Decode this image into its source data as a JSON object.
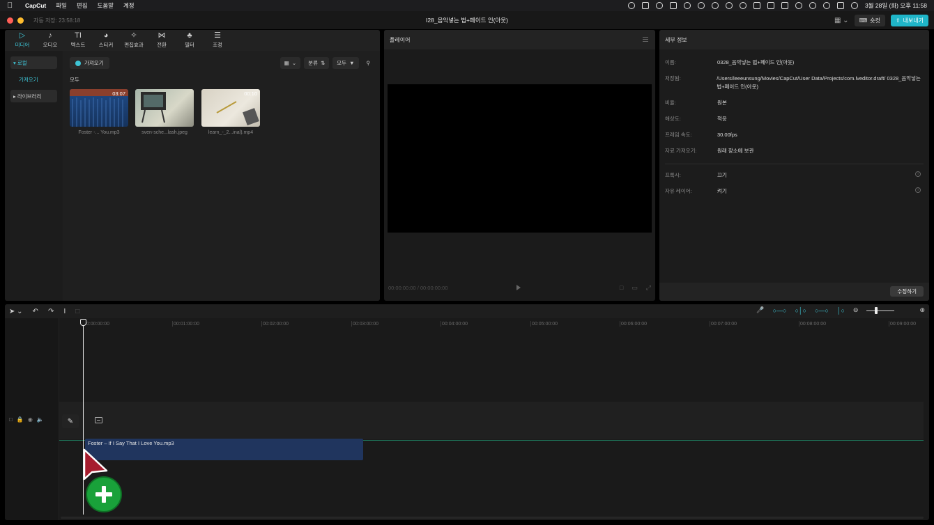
{
  "menubar": {
    "app": "CapCut",
    "items": [
      "파일",
      "편집",
      "도움말",
      "계정"
    ],
    "clock": "3월 28일 (화) 오후 11:58"
  },
  "window": {
    "autosave": "자동 저장: 23:58:18",
    "title": "I28_음악넣는 법+페이드 인(아웃)",
    "shortcut": "숏컷",
    "export": "내보내기"
  },
  "media": {
    "tabs": [
      {
        "label": "미디어",
        "icon": "media-icon"
      },
      {
        "label": "오디오",
        "icon": "audio-icon"
      },
      {
        "label": "텍스트",
        "icon": "text-icon"
      },
      {
        "label": "스티커",
        "icon": "sticker-icon"
      },
      {
        "label": "편집효과",
        "icon": "effects-icon"
      },
      {
        "label": "전환",
        "icon": "transition-icon"
      },
      {
        "label": "필터",
        "icon": "filter-icon"
      },
      {
        "label": "조정",
        "icon": "adjust-icon"
      }
    ],
    "sidebar": {
      "local": "로컬",
      "import": "가져오기",
      "library": "라이브러리"
    },
    "import_button": "가져오기",
    "sort_label": "분류",
    "filter_label": "모두",
    "section": "모두",
    "items": [
      {
        "name": "Foster -... You.mp3",
        "duration": "03:07"
      },
      {
        "name": "sven-sche...lash.jpeg",
        "duration": ""
      },
      {
        "name": "learn_-_2...inal).mp4",
        "duration": "00:10"
      }
    ]
  },
  "player": {
    "title": "플레이어",
    "timecode": "00:00:00:00 / 00:00:00:00"
  },
  "details": {
    "title": "세부 정보",
    "rows": [
      {
        "key": "이름:",
        "value": "0328_음악넣는 법+페이드 인(아웃)"
      },
      {
        "key": "저장됨:",
        "value": "/Users/leeeunsung/Movies/CapCut/User Data/Projects/com.lveditor.draft/ 0328_음악넣는 법+페이드 인(아웃)"
      },
      {
        "key": "비율:",
        "value": "원본"
      },
      {
        "key": "해상도:",
        "value": "적응"
      },
      {
        "key": "프레임 속도:",
        "value": "30.00fps"
      },
      {
        "key": "자료 가져오기:",
        "value": "원래 장소에 보관"
      },
      {
        "key": "프록시:",
        "value": "끄기"
      },
      {
        "key": "자유 레이어:",
        "value": "켜기"
      }
    ],
    "modify": "수정하기"
  },
  "timeline": {
    "ticks": [
      "00:00:00:00",
      "00:01:00:00",
      "00:02:00:00",
      "00:03:00:00",
      "00:04:00:00",
      "00:05:00:00",
      "00:06:00:00",
      "00:07:00:00",
      "00:08:00:00",
      "00:09:00:00"
    ],
    "audio_clip": "Foster – If I Say That I Love You.mp3"
  }
}
